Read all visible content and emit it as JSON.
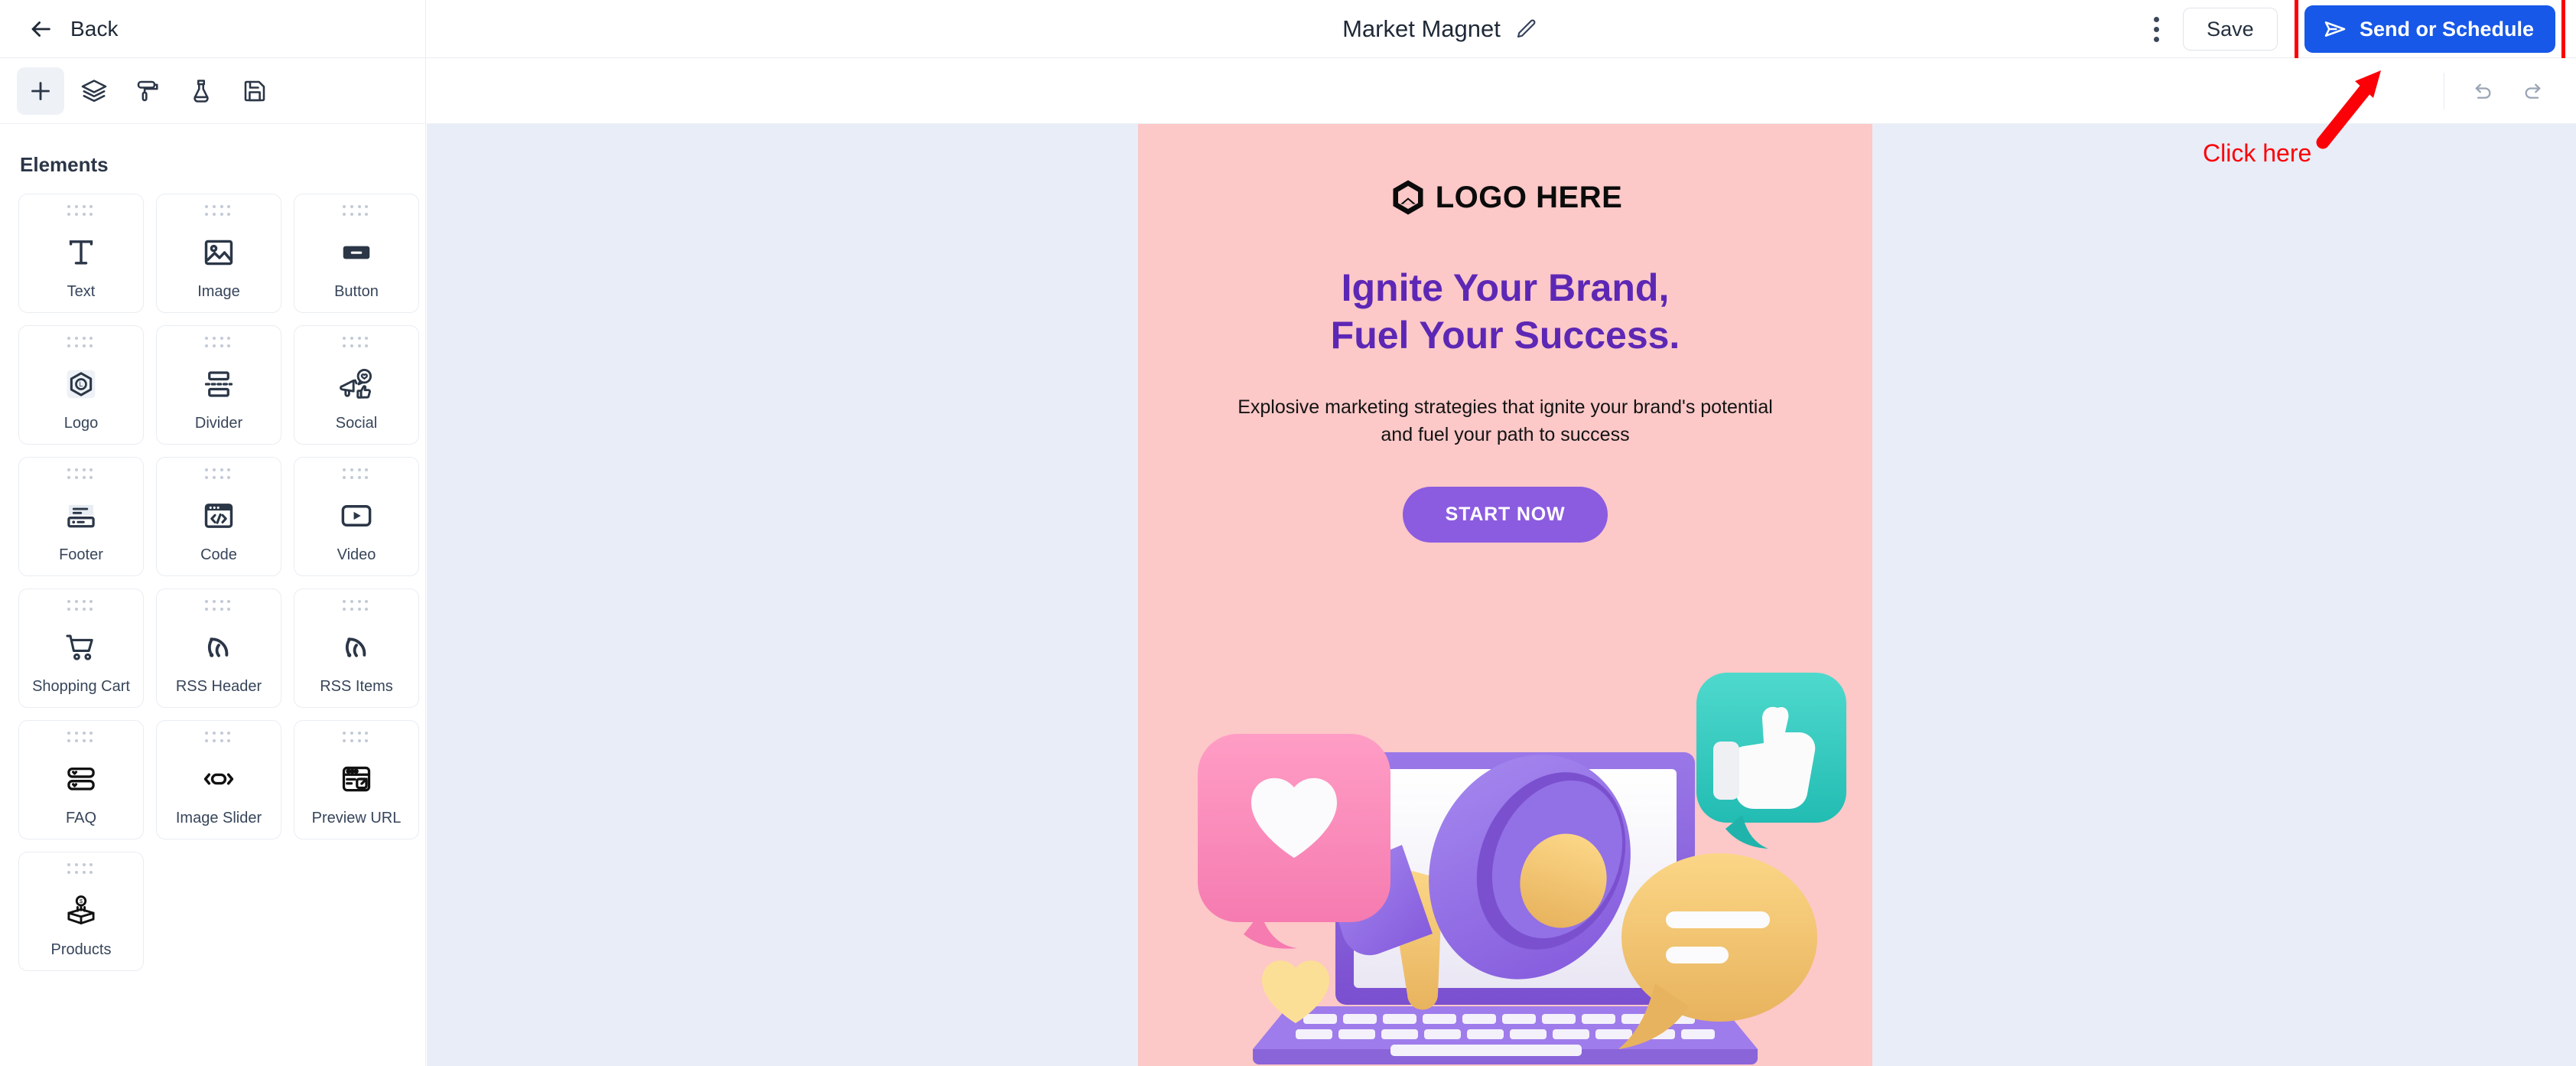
{
  "header": {
    "back_label": "Back",
    "back_icon": "arrow-left-icon",
    "title": "Market Magnet",
    "edit_icon": "pencil-icon",
    "menu_icon": "kebab-menu-icon",
    "save_label": "Save",
    "send_label": "Send or Schedule",
    "send_icon": "send-plane-icon",
    "accent_blue": "#1758e8"
  },
  "toolbar": {
    "items": [
      {
        "name": "add-element",
        "icon": "plus-icon",
        "active": true
      },
      {
        "name": "blocks",
        "icon": "layers-icon",
        "active": false
      },
      {
        "name": "styles",
        "icon": "paint-roller-icon",
        "active": false
      },
      {
        "name": "test",
        "icon": "flask-icon",
        "active": false
      },
      {
        "name": "save-template",
        "icon": "floppy-disk-icon",
        "active": false
      }
    ]
  },
  "panel": {
    "heading": "Elements",
    "elements": [
      {
        "label": "Text",
        "icon": "text-icon"
      },
      {
        "label": "Image",
        "icon": "image-icon"
      },
      {
        "label": "Button",
        "icon": "button-icon"
      },
      {
        "label": "Logo",
        "icon": "logo-hexagon-icon"
      },
      {
        "label": "Divider",
        "icon": "divider-icon"
      },
      {
        "label": "Social",
        "icon": "social-megaphone-icon"
      },
      {
        "label": "Footer",
        "icon": "footer-icon"
      },
      {
        "label": "Code",
        "icon": "code-window-icon"
      },
      {
        "label": "Video",
        "icon": "video-play-icon"
      },
      {
        "label": "Shopping Cart",
        "icon": "shopping-cart-icon"
      },
      {
        "label": "RSS Header",
        "icon": "rss-icon"
      },
      {
        "label": "RSS Items",
        "icon": "rss-icon"
      },
      {
        "label": "FAQ",
        "icon": "faq-accordion-icon"
      },
      {
        "label": "Image Slider",
        "icon": "image-slider-icon"
      },
      {
        "label": "Preview URL",
        "icon": "preview-url-icon"
      },
      {
        "label": "Products",
        "icon": "products-box-icon"
      }
    ]
  },
  "canvas": {
    "background": "#e8edf7",
    "undo_icon": "undo-arrow-icon",
    "redo_icon": "redo-arrow-icon"
  },
  "email": {
    "background": "#fcc8c8",
    "logo_text": "LOGO HERE",
    "logo_icon": "hexagon-logo-mark",
    "headline_line1": "Ignite Your Brand,",
    "headline_line2": "Fuel Your Success.",
    "headline_color": "#5d27b5",
    "subtext": "Explosive marketing strategies that ignite your brand's potential and fuel your path to success",
    "cta_label": "START NOW",
    "cta_color": "#8b5ce0",
    "illustration": "megaphone-laptop-social-3d"
  },
  "annotation": {
    "text": "Click here",
    "color": "#fb0007",
    "arrow_icon": "red-arrow-up-right",
    "highlight_target": "send-or-schedule-button"
  }
}
